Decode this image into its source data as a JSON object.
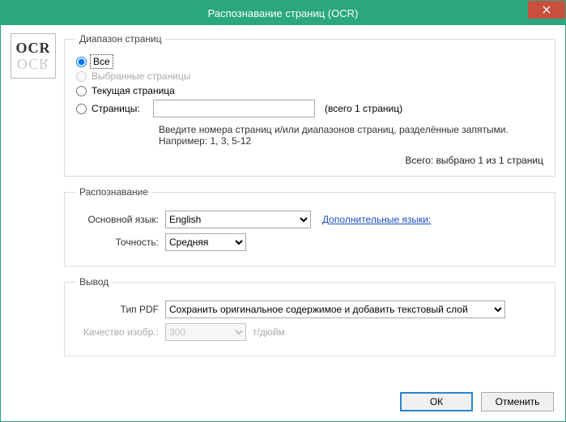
{
  "window": {
    "title": "Распознавание страниц (OCR)",
    "close_icon": "close"
  },
  "icon": {
    "top": "OCR",
    "bottom": "OCR"
  },
  "pageRange": {
    "legend": "Диапазон страниц",
    "radio_all": "Все",
    "radio_selected": "Выбранные страницы",
    "radio_current": "Текущая страница",
    "radio_pages": "Страницы:",
    "pages_value": "",
    "pages_count_suffix": "(всего 1 страниц)",
    "hint": "Введите номера страниц и/или диапазонов страниц, разделённые запятыми. Например: 1, 3, 5-12",
    "total_selected": "Всего: выбрано 1 из 1 страниц"
  },
  "recognition": {
    "legend": "Распознавание",
    "lang_label": "Основной язык:",
    "lang_value": "English",
    "more_langs_link": "Дополнительные языки:",
    "accuracy_label": "Точность:",
    "accuracy_value": "Средняя"
  },
  "output": {
    "legend": "Вывод",
    "pdf_type_label": "Тип PDF",
    "pdf_type_value": "Сохранить оригинальное содержимое и добавить текстовый слой",
    "quality_label": "Качество изобр.:",
    "quality_value": "300",
    "quality_unit": "т/дюйм"
  },
  "buttons": {
    "ok": "ОК",
    "cancel": "Отменить"
  }
}
